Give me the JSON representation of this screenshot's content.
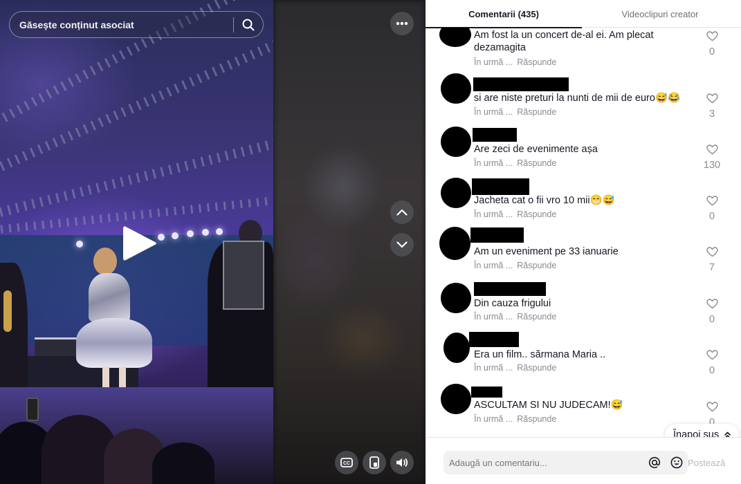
{
  "search": {
    "placeholder": "Găsește conținut asociat"
  },
  "icons": {
    "search": "search-icon",
    "more": "more-horizontal-icon",
    "up": "chevron-up-icon",
    "down": "chevron-down-icon",
    "play": "play-icon",
    "captions": "captions-icon",
    "pip": "picture-in-picture-icon",
    "volume": "volume-icon",
    "heart": "heart-icon",
    "mention": "at-mention-icon",
    "emoji": "emoji-icon",
    "back_top": "double-chevron-up-icon"
  },
  "tabs": [
    {
      "label": "Comentarii (435)",
      "active": true
    },
    {
      "label": "Videoclipuri creator",
      "active": false
    }
  ],
  "comments": [
    {
      "text": "Am fost la un concert de-al ei. Am plecat dezamagita",
      "time": "În urmă ...",
      "reply": "Răspunde",
      "likes": "0"
    },
    {
      "text": "si are niste preturi la nunti de mii de euro😅😂",
      "time": "În urmă ...",
      "reply": "Răspunde",
      "likes": "3"
    },
    {
      "text": "Are zeci de evenimente așa",
      "time": "În urmă ...",
      "reply": "Răspunde",
      "likes": "130"
    },
    {
      "text": "Jacheta cat o fii vro 10 mii😁😅",
      "time": "În urmă ...",
      "reply": "Răspunde",
      "likes": "0"
    },
    {
      "text": "Am un eveniment pe 33 ianuarie",
      "time": "În urmă ...",
      "reply": "Răspunde",
      "likes": "7"
    },
    {
      "text": "Din cauza frigului",
      "time": "În urmă ...",
      "reply": "Răspunde",
      "likes": "0"
    },
    {
      "text": "Era un film.. sărmana Maria ..",
      "time": "În urmă ...",
      "reply": "Răspunde",
      "likes": "0"
    },
    {
      "text": "ASCULTAM SI NU JUDECAM!😅",
      "time": "În urmă ...",
      "reply": "Răspunde",
      "likes": "0"
    }
  ],
  "back_to_top": {
    "label": "Înapoi sus"
  },
  "comment_bar": {
    "placeholder": "Adaugă un comentariu...",
    "post_label": "Postează"
  },
  "colors": {
    "text": "#161823",
    "muted": "#8a8b91",
    "panel_bg": "#ffffff",
    "input_bg": "#f1f1f2"
  }
}
